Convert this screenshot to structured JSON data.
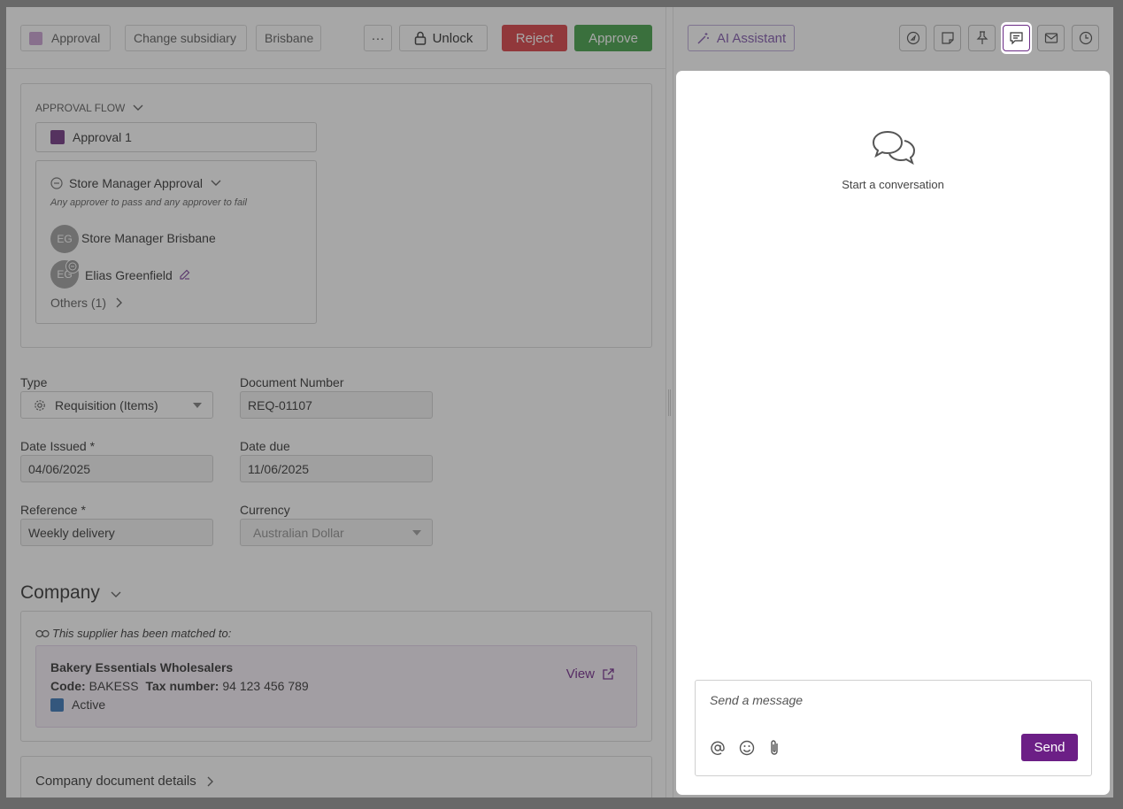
{
  "header": {
    "chip_approval": "Approval",
    "chip_change_subsidiary": "Change subsidiary",
    "chip_location": "Brisbane",
    "more_label": "···",
    "unlock_label": "Unlock",
    "reject_label": "Reject",
    "approve_label": "Approve"
  },
  "approval_flow": {
    "title": "APPROVAL FLOW",
    "stage": "Approval 1",
    "step_title": "Store Manager Approval",
    "step_rule": "Any approver to pass and any approver to fail",
    "approvers": [
      {
        "initials": "EG",
        "name": "Store Manager Brisbane"
      },
      {
        "initials": "EG",
        "name": "Elias Greenfield"
      }
    ],
    "others": "Others (1)"
  },
  "form": {
    "type_label": "Type",
    "type_value": "Requisition (Items)",
    "docnum_label": "Document Number",
    "docnum_value": "REQ-01107",
    "date_issued_label": "Date Issued *",
    "date_issued_value": "04/06/2025",
    "date_due_label": "Date due",
    "date_due_value": "11/06/2025",
    "reference_label": "Reference *",
    "reference_value": "Weekly delivery",
    "currency_label": "Currency",
    "currency_value": "Australian Dollar"
  },
  "company": {
    "title": "Company",
    "matched_text": "This supplier has been matched to:",
    "supplier_name": "Bakery Essentials Wholesalers",
    "code_label": "Code:",
    "code_value": "BAKESS",
    "tax_label": "Tax number:",
    "tax_value": "94 123 456 789",
    "status": "Active",
    "view_label": "View",
    "details_title": "Company document details"
  },
  "right_panel": {
    "ai_label": "AI Assistant",
    "empty_text": "Start a conversation",
    "message_placeholder": "Send a message",
    "send_label": "Send"
  },
  "colors": {
    "primary": "#6c1f86",
    "reject": "#d7363b",
    "approve": "#3a9b3e",
    "stage_swatch": "#6b2a7d",
    "status_swatch": "#2f6db3"
  }
}
